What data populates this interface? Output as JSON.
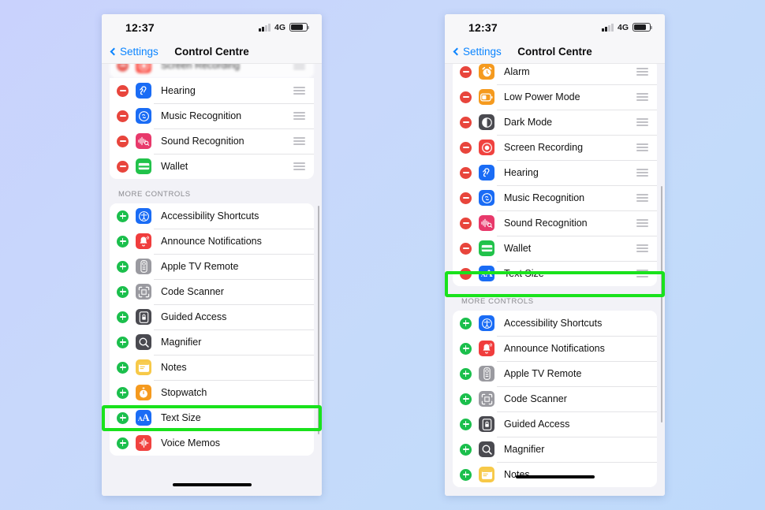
{
  "background": {
    "color_start": "#c9d2fd",
    "color_end": "#bed9fb"
  },
  "accent": {
    "highlight_green": "#19e21c",
    "remove_red": "#e8453c",
    "add_green": "#1bbf4c",
    "link_blue": "#0a84ff"
  },
  "phones": [
    {
      "id": "left",
      "statusbar": {
        "time": "12:37",
        "network": "4G"
      },
      "navbar": {
        "back_label": "Settings",
        "title": "Control Centre"
      },
      "partial_top_row": {
        "label": "Screen Recording",
        "toggle": "minus",
        "icon": "screen-recording-icon",
        "icon_bg": "#ff3b30"
      },
      "included_section": {
        "rows": [
          {
            "label": "Hearing",
            "toggle": "minus",
            "icon": "hearing-icon",
            "icon_bg": "#1a6cf5"
          },
          {
            "label": "Music Recognition",
            "toggle": "minus",
            "icon": "shazam-icon",
            "icon_bg": "#1a6cf5"
          },
          {
            "label": "Sound Recognition",
            "toggle": "minus",
            "icon": "sound-recognition-icon",
            "icon_bg": "#e8396b"
          },
          {
            "label": "Wallet",
            "toggle": "minus",
            "icon": "wallet-icon",
            "icon_bg": "#21c24a"
          }
        ]
      },
      "more_section": {
        "header": "MORE CONTROLS",
        "rows": [
          {
            "label": "Accessibility Shortcuts",
            "toggle": "plus",
            "icon": "accessibility-icon",
            "icon_bg": "#1a6cf5"
          },
          {
            "label": "Announce Notifications",
            "toggle": "plus",
            "icon": "announce-notifications-icon",
            "icon_bg": "#f03d3d"
          },
          {
            "label": "Apple TV Remote",
            "toggle": "plus",
            "icon": "apple-tv-remote-icon",
            "icon_bg": "#9a9aa0"
          },
          {
            "label": "Code Scanner",
            "toggle": "plus",
            "icon": "code-scanner-icon",
            "icon_bg": "#9a9aa0"
          },
          {
            "label": "Guided Access",
            "toggle": "plus",
            "icon": "guided-access-icon",
            "icon_bg": "#4a4a50"
          },
          {
            "label": "Magnifier",
            "toggle": "plus",
            "icon": "magnifier-icon",
            "icon_bg": "#4a4a50"
          },
          {
            "label": "Notes",
            "toggle": "plus",
            "icon": "notes-icon",
            "icon_bg": "#f7c948"
          },
          {
            "label": "Stopwatch",
            "toggle": "plus",
            "icon": "stopwatch-icon",
            "icon_bg": "#f59a1e"
          },
          {
            "label": "Text Size",
            "toggle": "plus",
            "icon": "text-size-icon",
            "icon_bg": "#1a6cf5",
            "highlighted": true
          },
          {
            "label": "Voice Memos",
            "toggle": "plus",
            "icon": "voice-memos-icon",
            "icon_bg": "#f0423f"
          }
        ]
      }
    },
    {
      "id": "right",
      "statusbar": {
        "time": "12:37",
        "network": "4G"
      },
      "navbar": {
        "back_label": "Settings",
        "title": "Control Centre"
      },
      "included_section": {
        "rows": [
          {
            "label": "Alarm",
            "toggle": "minus",
            "icon": "alarm-icon",
            "icon_bg": "#f59a1e"
          },
          {
            "label": "Low Power Mode",
            "toggle": "minus",
            "icon": "low-power-mode-icon",
            "icon_bg": "#f59a1e"
          },
          {
            "label": "Dark Mode",
            "toggle": "minus",
            "icon": "dark-mode-icon",
            "icon_bg": "#4a4a50"
          },
          {
            "label": "Screen Recording",
            "toggle": "minus",
            "icon": "screen-recording-icon",
            "icon_bg": "#f0423f"
          },
          {
            "label": "Hearing",
            "toggle": "minus",
            "icon": "hearing-icon",
            "icon_bg": "#1a6cf5"
          },
          {
            "label": "Music Recognition",
            "toggle": "minus",
            "icon": "shazam-icon",
            "icon_bg": "#1a6cf5"
          },
          {
            "label": "Sound Recognition",
            "toggle": "minus",
            "icon": "sound-recognition-icon",
            "icon_bg": "#e8396b"
          },
          {
            "label": "Wallet",
            "toggle": "minus",
            "icon": "wallet-icon",
            "icon_bg": "#21c24a"
          },
          {
            "label": "Text Size",
            "toggle": "minus",
            "icon": "text-size-icon",
            "icon_bg": "#1a6cf5",
            "highlighted": true
          }
        ]
      },
      "more_section": {
        "header": "MORE CONTROLS",
        "rows": [
          {
            "label": "Accessibility Shortcuts",
            "toggle": "plus",
            "icon": "accessibility-icon",
            "icon_bg": "#1a6cf5"
          },
          {
            "label": "Announce Notifications",
            "toggle": "plus",
            "icon": "announce-notifications-icon",
            "icon_bg": "#f03d3d"
          },
          {
            "label": "Apple TV Remote",
            "toggle": "plus",
            "icon": "apple-tv-remote-icon",
            "icon_bg": "#9a9aa0"
          },
          {
            "label": "Code Scanner",
            "toggle": "plus",
            "icon": "code-scanner-icon",
            "icon_bg": "#9a9aa0"
          },
          {
            "label": "Guided Access",
            "toggle": "plus",
            "icon": "guided-access-icon",
            "icon_bg": "#4a4a50"
          },
          {
            "label": "Magnifier",
            "toggle": "plus",
            "icon": "magnifier-icon",
            "icon_bg": "#4a4a50"
          },
          {
            "label": "Notes",
            "toggle": "plus",
            "icon": "notes-icon",
            "icon_bg": "#f7c948"
          }
        ]
      }
    }
  ]
}
